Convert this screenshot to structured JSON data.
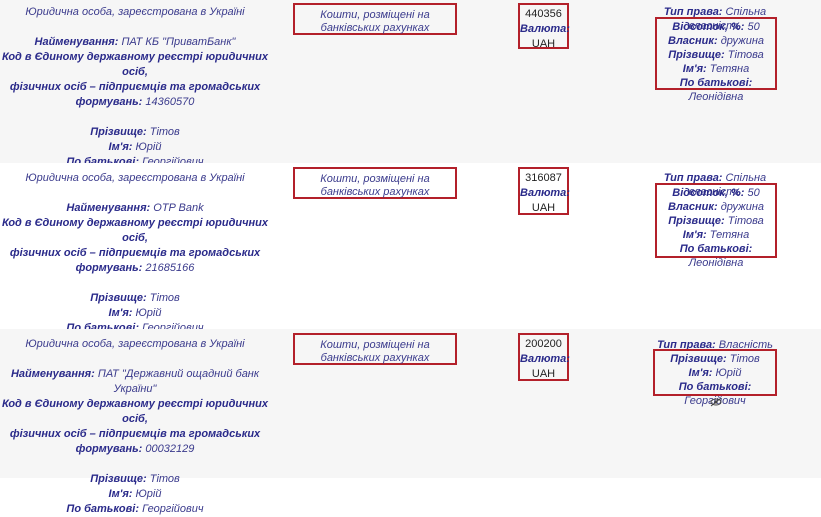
{
  "rows": [
    {
      "entity_type": "Юридична особа, зареєстрована в Україні",
      "name_label": "Найменування:",
      "name_value": "ПАТ КБ \"ПриватБанк\"",
      "code_label_1": "Код в Єдиному державному реєстрі юридичних осіб,",
      "code_label_2": "фізичних осіб – підприємців та громадських",
      "code_label_3": "формувань:",
      "code_value": "14360570",
      "surname_label": "Прізвище:",
      "surname_value": "Тітов",
      "firstname_label": "Ім'я:",
      "firstname_value": "Юрій",
      "patronymic_label": "По батькові:",
      "patronymic_value": "Георгійович",
      "asset_type": "Кошти, розміщені на банківських рахунках",
      "amount": "440356",
      "currency_label": "Валюта:",
      "currency_value": "UAH",
      "right_type_label": "Тип права:",
      "right_type_value": "Спільна власність",
      "share_label": "Відсоток, %:",
      "share_value": "50",
      "owner_label": "Власник:",
      "owner_value": "дружина",
      "o_surname_label": "Прізвище:",
      "o_surname_value": "Тітова",
      "o_firstname_label": "Ім'я:",
      "o_firstname_value": "Тетяна",
      "o_patronymic_label": "По батькові:",
      "o_patronymic_value": "Леонідівна"
    },
    {
      "entity_type": "Юридична особа, зареєстрована в Україні",
      "name_label": "Найменування:",
      "name_value": "OTP Bank",
      "code_label_1": "Код в Єдиному державному реєстрі юридичних осіб,",
      "code_label_2": "фізичних осіб – підприємців та громадських",
      "code_label_3": "формувань:",
      "code_value": "21685166",
      "surname_label": "Прізвище:",
      "surname_value": "Тітов",
      "firstname_label": "Ім'я:",
      "firstname_value": "Юрій",
      "patronymic_label": "По батькові:",
      "patronymic_value": "Георгійович",
      "asset_type": "Кошти, розміщені на банківських рахунках",
      "amount": "316087",
      "currency_label": "Валюта:",
      "currency_value": "UAH",
      "right_type_label": "Тип права:",
      "right_type_value": "Спільна власність",
      "share_label": "Відсоток, %:",
      "share_value": "50",
      "owner_label": "Власник:",
      "owner_value": "дружина",
      "o_surname_label": "Прізвище:",
      "o_surname_value": "Тітова",
      "o_firstname_label": "Ім'я:",
      "o_firstname_value": "Тетяна",
      "o_patronymic_label": "По батькові:",
      "o_patronymic_value": "Леонідівна"
    },
    {
      "entity_type": "Юридична особа, зареєстрована в Україні",
      "name_label": "Найменування:",
      "name_value": "ПАТ \"Державний ощадний банк України\"",
      "code_label_1": "Код в Єдиному державному реєстрі юридичних осіб,",
      "code_label_2": "фізичних осіб – підприємців та громадських",
      "code_label_3": "формувань:",
      "code_value": "00032129",
      "surname_label": "Прізвище:",
      "surname_value": "Тітов",
      "firstname_label": "Ім'я:",
      "firstname_value": "Юрій",
      "patronymic_label": "По батькові:",
      "patronymic_value": "Георгійович",
      "asset_type": "Кошти, розміщені на банківських рахунках",
      "amount": "200200",
      "currency_label": "Валюта:",
      "currency_value": "UAH",
      "right_type_label": "Тип права:",
      "right_type_value": "Власність",
      "o_surname_label": "Прізвище:",
      "o_surname_value": "Тітов",
      "o_firstname_label": "Ім'я:",
      "o_firstname_value": "Юрій",
      "o_patronymic_label": "По батькові:",
      "o_patronymic_value": "Георгійович"
    }
  ],
  "icons": {
    "view": "eye-icon"
  },
  "colors": {
    "highlight_border": "#b3202a",
    "text_blue": "#2a2a8a",
    "row_shade": "#f6f6f6"
  }
}
